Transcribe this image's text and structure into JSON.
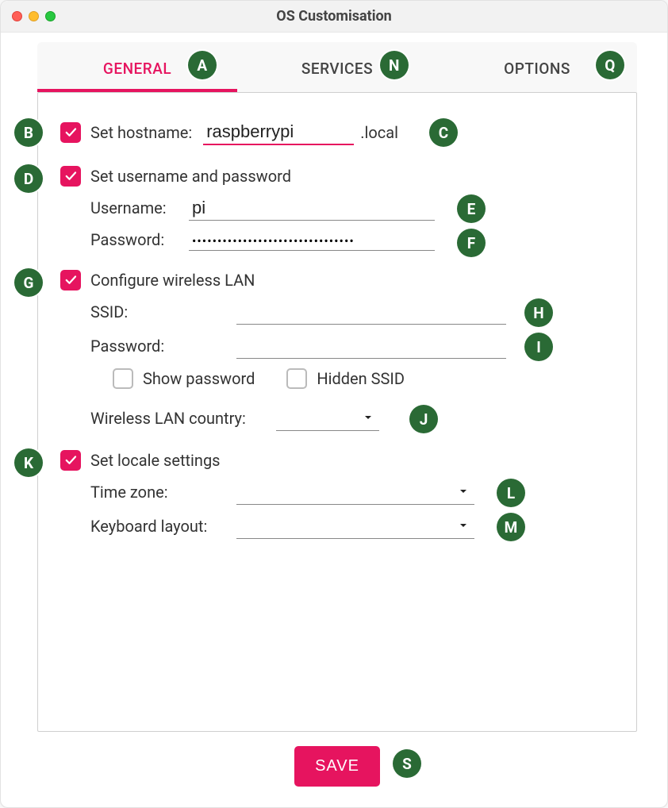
{
  "window": {
    "title": "OS Customisation"
  },
  "tabs": {
    "general": "GENERAL",
    "services": "SERVICES",
    "options": "OPTIONS",
    "active": "general"
  },
  "hostname": {
    "checkbox_label": "Set hostname:",
    "value": "raspberrypi",
    "suffix": ".local",
    "checked": true
  },
  "credentials": {
    "checkbox_label": "Set username and password",
    "checked": true,
    "username_label": "Username:",
    "username_value": "pi",
    "password_label": "Password:",
    "password_value": "••••••••••••••••••••••••••••••••"
  },
  "wifi": {
    "checkbox_label": "Configure wireless LAN",
    "checked": true,
    "ssid_label": "SSID:",
    "ssid_value": "",
    "password_label": "Password:",
    "password_value": "",
    "show_password_label": "Show password",
    "show_password_checked": false,
    "hidden_ssid_label": "Hidden SSID",
    "hidden_ssid_checked": false,
    "country_label": "Wireless LAN country:",
    "country_value": ""
  },
  "locale": {
    "checkbox_label": "Set locale settings",
    "checked": true,
    "timezone_label": "Time zone:",
    "timezone_value": "",
    "keyboard_label": "Keyboard layout:",
    "keyboard_value": ""
  },
  "buttons": {
    "save": "SAVE"
  },
  "annotations": {
    "A": "A",
    "B": "B",
    "C": "C",
    "D": "D",
    "E": "E",
    "F": "F",
    "G": "G",
    "H": "H",
    "I": "I",
    "J": "J",
    "K": "K",
    "L": "L",
    "M": "M",
    "N": "N",
    "Q": "Q",
    "S": "S"
  },
  "colors": {
    "accent": "#e6145f",
    "annotation": "#2a6a35"
  }
}
